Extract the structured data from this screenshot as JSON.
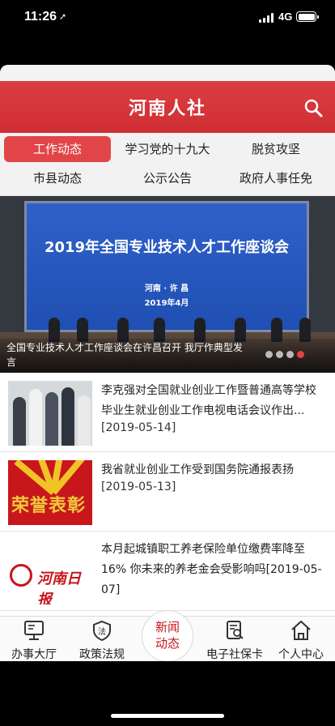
{
  "status_bar": {
    "time": "11:26",
    "network": "4G"
  },
  "header": {
    "title": "河南人社"
  },
  "tabs": [
    {
      "label": "工作动态",
      "active": true
    },
    {
      "label": "学习党的十九大"
    },
    {
      "label": "脱贫攻坚"
    },
    {
      "label": "市县动态"
    },
    {
      "label": "公示公告"
    },
    {
      "label": "政府人事任免"
    }
  ],
  "banner": {
    "board_title": "2019年全国专业技术人才工作座谈会",
    "board_location": "河南 · 许 昌",
    "board_date": "2019年4月",
    "caption": "全国专业技术人才工作座谈会在许昌召开 我厅作典型发言",
    "slides_total": 4,
    "active_slide": 4
  },
  "news": [
    {
      "title": "李克强对全国就业创业工作暨普通高等学校毕业生就业创业工作电视电话会议作出...",
      "date": "[2019-05-14]"
    },
    {
      "title": "我省就业创业工作受到国务院通报表扬",
      "date": "[2019-05-13]",
      "thumb_text": "荣誉表彰"
    },
    {
      "title": "本月起城镇职工养老保险单位缴费率降至16% 你未来的养老金会受影响吗[2019-05-07]",
      "thumb_text": "河南日报"
    }
  ],
  "bottom_nav": {
    "items": [
      {
        "label": "办事大厅",
        "icon": "monitor-icon"
      },
      {
        "label": "政策法规",
        "icon": "law-shield-icon"
      },
      {
        "label": "电子社保卡",
        "icon": "card-search-icon"
      },
      {
        "label": "个人中心",
        "icon": "house-icon"
      }
    ],
    "center_label": "新闻\n动态",
    "center_line1": "新闻",
    "center_line2": "动态"
  },
  "colors": {
    "brand_red": "#d9363b",
    "active_tab": "#e24548"
  }
}
